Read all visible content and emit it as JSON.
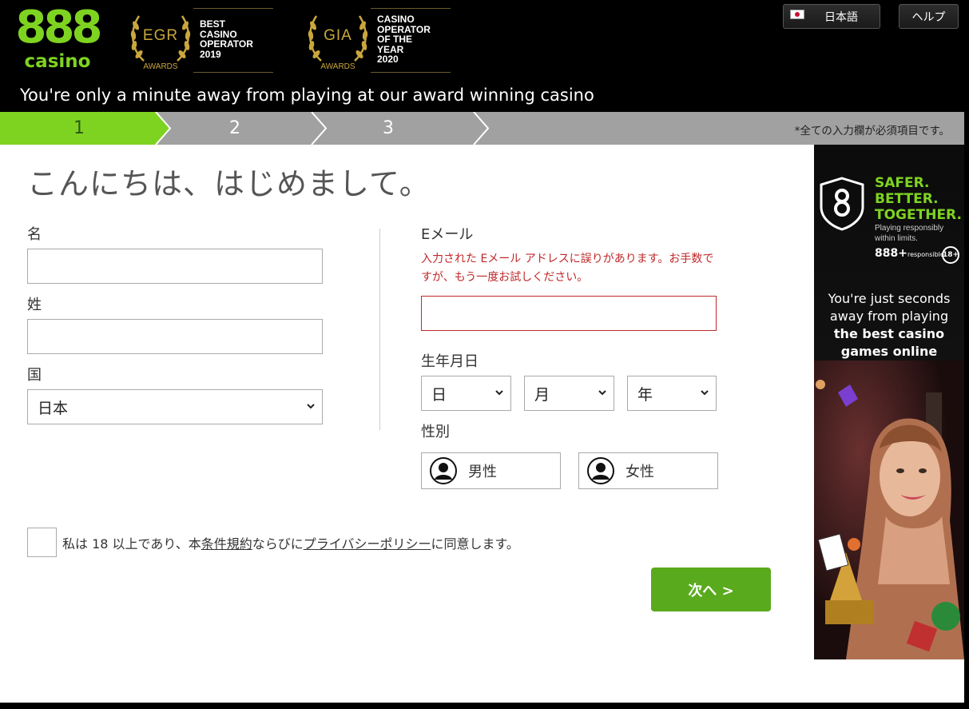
{
  "header": {
    "logo_number": "888",
    "logo_word": "casino",
    "awards": [
      {
        "abbr": "EGR",
        "label": "AWARDS",
        "lines": [
          "BEST",
          "CASINO",
          "OPERATOR",
          "2019"
        ]
      },
      {
        "abbr": "GIA",
        "label": "AWARDS",
        "lines": [
          "CASINO",
          "OPERATOR",
          "OF THE",
          "YEAR",
          "2020"
        ]
      }
    ],
    "language_button": "日本語",
    "help_button": "ヘルプ",
    "tagline": "You're only a minute away from playing at our award winning casino"
  },
  "steps": {
    "items": [
      "1",
      "2",
      "3"
    ],
    "active": "1",
    "required_note": "*全ての入力欄が必須項目です。"
  },
  "form": {
    "greeting": "こんにちは、はじめまして。",
    "first_name_label": "名",
    "first_name_value": "",
    "last_name_label": "姓",
    "last_name_value": "",
    "country_label": "国",
    "country_value": "日本",
    "email_label": "Eメール",
    "email_error": "入力された Eメール アドレスに誤りがあります。お手数ですが、もう一度お試しください。",
    "email_value": "",
    "dob_label": "生年月日",
    "dob_day": "日",
    "dob_month": "月",
    "dob_year": "年",
    "gender_label": "性別",
    "gender_male": "男性",
    "gender_female": "女性",
    "terms_prefix": "私は 18 以上であり、本",
    "terms_link": "条件規約",
    "terms_middle": "ならびに",
    "privacy_link": "プライバシーポリシー",
    "terms_suffix": "に同意します。",
    "terms_checked": false,
    "next_button": "次へ >"
  },
  "banner": {
    "headline": [
      "SAFER.",
      "BETTER.",
      "TOGETHER."
    ],
    "sub": "Playing responsibly within limits.",
    "responsible_brand": "888+",
    "responsible_word": "responsible",
    "age_badge": "18+",
    "copy_lines": [
      "You're just seconds",
      "away from playing",
      "the best casino",
      "games online"
    ]
  },
  "colors": {
    "brand_green": "#7ed321",
    "button_green": "#5aaa1d",
    "error_red": "#c0292b",
    "step_gray": "#a1a1a1",
    "award_gold": "#c9a73d"
  }
}
